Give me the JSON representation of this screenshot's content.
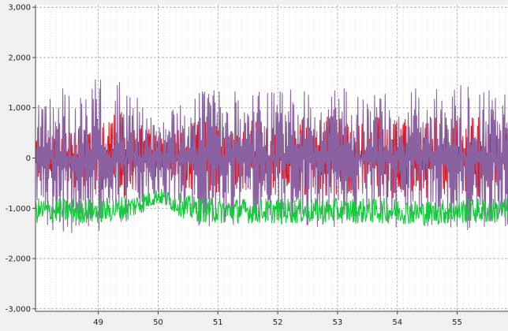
{
  "chart_data": {
    "type": "line",
    "title": "",
    "xlabel": "",
    "ylabel": "",
    "xlim": [
      47.95,
      55.85
    ],
    "ylim": [
      -3050,
      3050
    ],
    "x_ticks": [
      {
        "value": 49,
        "label": "49"
      },
      {
        "value": 50,
        "label": "50"
      },
      {
        "value": 51,
        "label": "51"
      },
      {
        "value": 52,
        "label": "52"
      },
      {
        "value": 53,
        "label": "53"
      },
      {
        "value": 54,
        "label": "54"
      },
      {
        "value": 55,
        "label": "55"
      }
    ],
    "y_ticks": [
      {
        "value": 3000,
        "label": "3,000"
      },
      {
        "value": 2000,
        "label": "2,000"
      },
      {
        "value": 1000,
        "label": "1,000"
      },
      {
        "value": 0,
        "label": "0"
      },
      {
        "value": -1000,
        "label": "-1,000"
      },
      {
        "value": -2000,
        "label": "-2,000"
      },
      {
        "value": -3000,
        "label": "-3,000"
      }
    ],
    "grid": true,
    "minor_grid_x_step": 0.1,
    "colors": {
      "background": "#f0f0f0",
      "plot_background": "#ffffff",
      "grid_major": "#a8a8a8",
      "grid_minor": "#d0d0d0",
      "axis": "#444444"
    },
    "series": [
      {
        "color": "#e8141c",
        "x": [
          48.0,
          48.5,
          49.0,
          49.5,
          50.0,
          50.5,
          51.0,
          51.5,
          52.0,
          52.5,
          53.0,
          53.5,
          54.0,
          54.5,
          55.0,
          55.5,
          55.85
        ],
        "y_max": [
          500,
          700,
          850,
          900,
          450,
          700,
          800,
          750,
          800,
          850,
          850,
          800,
          850,
          850,
          900,
          850,
          800
        ],
        "y_min": [
          -500,
          -700,
          -800,
          -800,
          -350,
          -650,
          -750,
          -700,
          -750,
          -800,
          -750,
          -750,
          -800,
          -800,
          -800,
          -800,
          -750
        ]
      },
      {
        "color": "#8a62a2",
        "x": [
          48.0,
          48.5,
          49.0,
          49.5,
          50.0,
          50.5,
          51.0,
          51.5,
          52.0,
          52.5,
          53.0,
          53.5,
          54.0,
          54.5,
          55.0,
          55.5,
          55.85
        ],
        "y_max": [
          1150,
          1450,
          1600,
          1500,
          700,
          1250,
          1400,
          1300,
          1350,
          1350,
          1450,
          1250,
          1350,
          1400,
          1450,
          1400,
          1350
        ],
        "y_min": [
          -1450,
          -1500,
          -1500,
          -1450,
          -800,
          -1350,
          -1400,
          -1350,
          -1350,
          -1400,
          -1400,
          -1300,
          -1450,
          -1400,
          -1450,
          -1400,
          -1350
        ]
      },
      {
        "color": "#13cc39",
        "x": [
          48.0,
          48.5,
          49.0,
          49.5,
          50.0,
          50.5,
          51.0,
          51.5,
          52.0,
          52.5,
          53.0,
          53.5,
          54.0,
          54.5,
          55.0,
          55.5,
          55.85
        ],
        "y_center": [
          -1050,
          -1050,
          -1050,
          -1000,
          -750,
          -1000,
          -1050,
          -1050,
          -1050,
          -1050,
          -1050,
          -1050,
          -1050,
          -1100,
          -1050,
          -1050,
          -1050
        ],
        "y_halfwidth": [
          250,
          250,
          250,
          250,
          150,
          250,
          250,
          250,
          250,
          250,
          250,
          250,
          250,
          250,
          250,
          250,
          250
        ]
      }
    ]
  }
}
